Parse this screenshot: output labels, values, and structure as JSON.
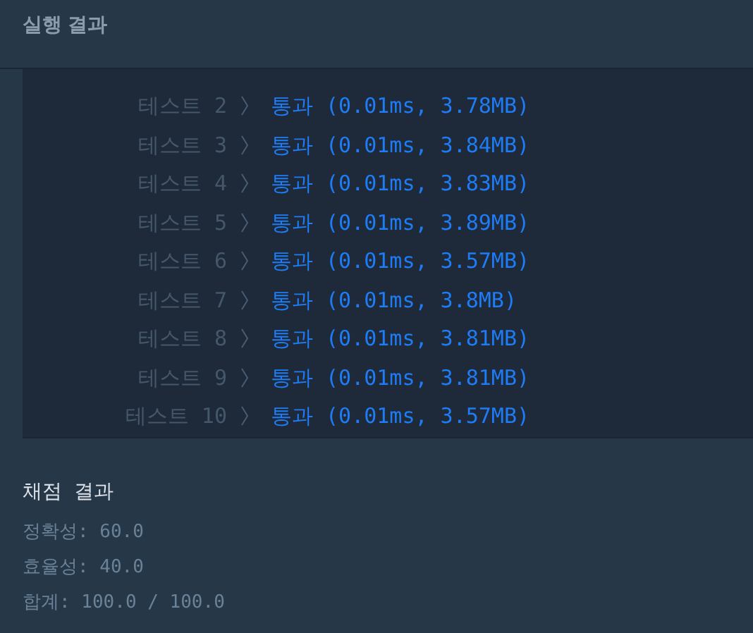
{
  "header": {
    "title": "실행 결과"
  },
  "results": [
    {
      "label": "테스트 2",
      "result": "통과 (0.01ms, 3.78MB)"
    },
    {
      "label": "테스트 3",
      "result": "통과 (0.01ms, 3.84MB)"
    },
    {
      "label": "테스트 4",
      "result": "통과 (0.01ms, 3.83MB)"
    },
    {
      "label": "테스트 5",
      "result": "통과 (0.01ms, 3.89MB)"
    },
    {
      "label": "테스트 6",
      "result": "통과 (0.01ms, 3.57MB)"
    },
    {
      "label": "테스트 7",
      "result": "통과 (0.01ms, 3.8MB)"
    },
    {
      "label": "테스트 8",
      "result": "통과 (0.01ms, 3.81MB)"
    },
    {
      "label": "테스트 9",
      "result": "통과 (0.01ms, 3.81MB)"
    },
    {
      "label": "테스트 10",
      "result": "통과 (0.01ms, 3.57MB)"
    }
  ],
  "grading": {
    "title": "채점 결과",
    "lines": [
      "정확성: 60.0",
      "효율성: 40.0",
      "합계: 100.0 / 100.0"
    ]
  }
}
